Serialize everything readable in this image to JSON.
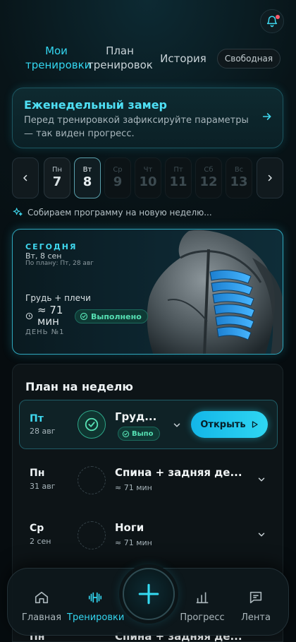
{
  "header": {
    "tabs": [
      {
        "label": "Мои тренировки",
        "active": true
      },
      {
        "label": "План тренировок",
        "active": false
      },
      {
        "label": "История",
        "active": false
      }
    ],
    "free_label": "Свободная",
    "bell_icon": "bell-icon"
  },
  "weekly": {
    "title": "Еженедельный замер",
    "text": "Перед тренировкой зафиксируйте параметры — так виден прогресс."
  },
  "days": [
    {
      "name": "Пн",
      "num": "7",
      "state": "past"
    },
    {
      "name": "Вт",
      "num": "8",
      "state": "today"
    },
    {
      "name": "Ср",
      "num": "9",
      "state": "future"
    },
    {
      "name": "Чт",
      "num": "10",
      "state": "future"
    },
    {
      "name": "Пт",
      "num": "11",
      "state": "future"
    },
    {
      "name": "Сб",
      "num": "12",
      "state": "future"
    },
    {
      "name": "Вс",
      "num": "13",
      "state": "future"
    }
  ],
  "program_note": "Собираем программу на новую неделю...",
  "today": {
    "label": "СЕГОДНЯ",
    "date": "Вт, 8 сен",
    "plan": "По плану: Пт, 28 авг",
    "workout": "Грудь + плечи",
    "duration": "≈ 71 мин",
    "status": "Выполнено",
    "day": "ДЕНЬ №1"
  },
  "plan": {
    "title": "План на неделю",
    "rows": [
      {
        "day": "Пт",
        "date": "28 авг",
        "name": "Груд...",
        "badge": "Выпо",
        "open": "Открыть"
      },
      {
        "day": "Пн",
        "date": "31 авг",
        "name": "Спина + задняя де...",
        "sub": "≈ 71 мин"
      },
      {
        "day": "Ср",
        "date": "2 сен",
        "name": "Ноги",
        "sub": "≈ 71 мин"
      },
      {
        "day": "Пн",
        "date": "",
        "name": "Спина + задняя де...",
        "sub": ""
      }
    ]
  },
  "bottom_nav": {
    "items": [
      {
        "label": "Главная",
        "icon": "home-icon",
        "active": false
      },
      {
        "label": "Тренировки",
        "icon": "dumbbell-icon",
        "active": true
      },
      {
        "label": "Прогресс",
        "icon": "chart-icon",
        "active": false
      },
      {
        "label": "Лента",
        "icon": "feed-icon",
        "active": false
      }
    ],
    "fab_icon": "plus-icon"
  },
  "colors": {
    "accent": "#33d6f0",
    "success": "#56e0b3",
    "background": "#081418"
  }
}
